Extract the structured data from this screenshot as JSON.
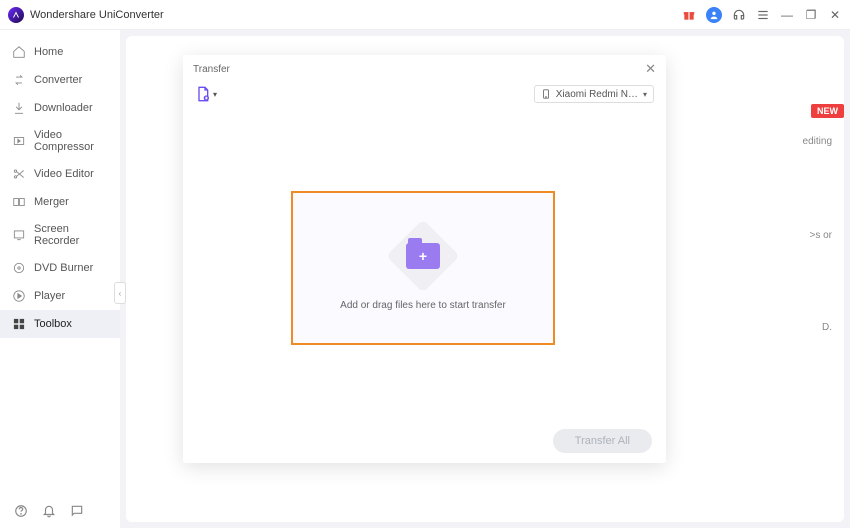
{
  "app": {
    "title": "Wondershare UniConverter"
  },
  "titlebar_icons": {
    "gift": "gift-icon",
    "avatar": "A",
    "headset": "support-icon",
    "menu": "menu-icon",
    "minimize": "—",
    "maximize": "❐",
    "close": "✕"
  },
  "sidebar": {
    "items": [
      {
        "label": "Home"
      },
      {
        "label": "Converter"
      },
      {
        "label": "Downloader"
      },
      {
        "label": "Video Compressor"
      },
      {
        "label": "Video Editor"
      },
      {
        "label": "Merger"
      },
      {
        "label": "Screen Recorder"
      },
      {
        "label": "DVD Burner"
      },
      {
        "label": "Player"
      },
      {
        "label": "Toolbox"
      }
    ],
    "handle": "‹"
  },
  "workspace": {
    "new_badge": "NEW",
    "bg_fragments": {
      "t1": "editing",
      "t2": ">s or",
      "t3": "D."
    }
  },
  "modal": {
    "title": "Transfer",
    "close": "✕",
    "device": {
      "label": "Xiaomi Redmi N…",
      "chevron": "▾"
    },
    "add_chevron": "▾",
    "dropzone_text": "Add or drag files here to start transfer",
    "folder_plus": "+",
    "transfer_button": "Transfer All"
  }
}
